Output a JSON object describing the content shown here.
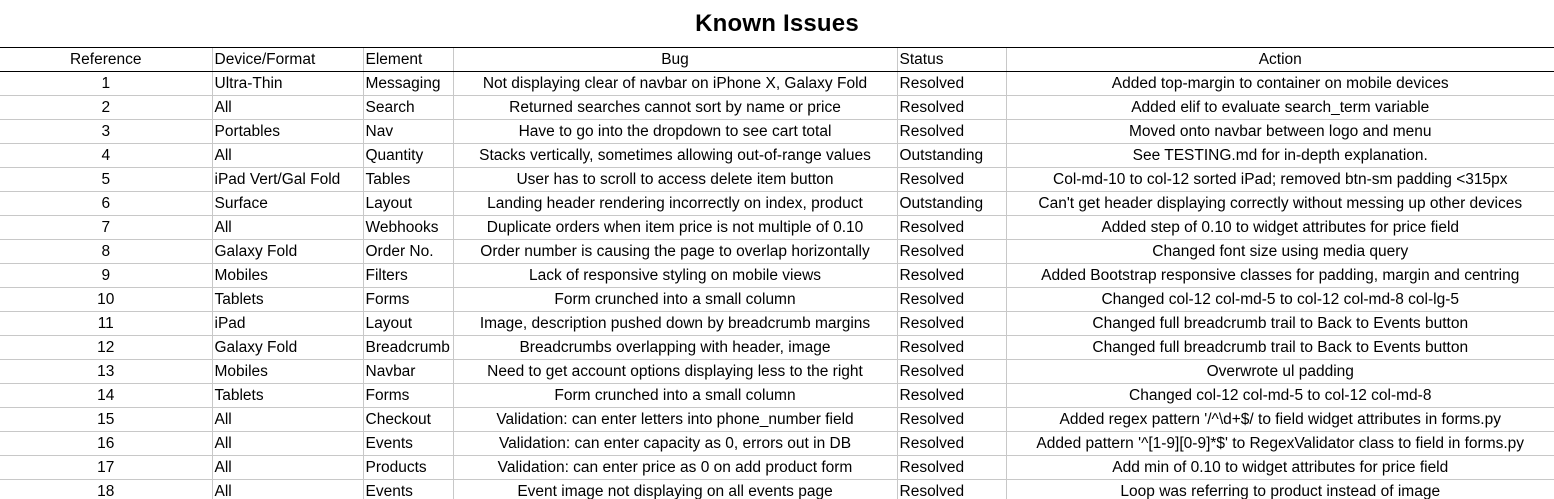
{
  "title": "Known Issues",
  "columns": [
    "Reference",
    "Device/Format",
    "Element",
    "Bug",
    "Status",
    "Action"
  ],
  "rows": [
    {
      "ref": "1",
      "device": "Ultra-Thin",
      "element": "Messaging",
      "bug": "Not displaying clear of navbar on iPhone X, Galaxy Fold",
      "status": "Resolved",
      "action": "Added top-margin to container on mobile devices"
    },
    {
      "ref": "2",
      "device": "All",
      "element": "Search",
      "bug": "Returned searches cannot sort by name or price",
      "status": "Resolved",
      "action": "Added elif to evaluate search_term variable"
    },
    {
      "ref": "3",
      "device": "Portables",
      "element": "Nav",
      "bug": "Have to go into the dropdown to see cart total",
      "status": "Resolved",
      "action": "Moved onto navbar between logo and menu"
    },
    {
      "ref": "4",
      "device": "All",
      "element": "Quantity",
      "bug": "Stacks vertically, sometimes allowing out-of-range values",
      "status": "Outstanding",
      "action": "See TESTING.md for in-depth explanation."
    },
    {
      "ref": "5",
      "device": "iPad Vert/Gal Fold",
      "element": "Tables",
      "bug": "User has to scroll to access delete item button",
      "status": "Resolved",
      "action": "Col-md-10 to col-12 sorted iPad; removed btn-sm padding <315px"
    },
    {
      "ref": "6",
      "device": "Surface",
      "element": "Layout",
      "bug": "Landing header rendering incorrectly on index, product",
      "status": "Outstanding",
      "action": "Can't get header displaying correctly without messing up other devices"
    },
    {
      "ref": "7",
      "device": "All",
      "element": "Webhooks",
      "bug": "Duplicate orders when item price is not multiple of 0.10",
      "status": "Resolved",
      "action": "Added step of 0.10 to widget attributes for price field"
    },
    {
      "ref": "8",
      "device": "Galaxy Fold",
      "element": "Order No.",
      "bug": "Order number is causing the page to overlap horizontally",
      "status": "Resolved",
      "action": "Changed font size using media query"
    },
    {
      "ref": "9",
      "device": "Mobiles",
      "element": "Filters",
      "bug": "Lack of responsive styling on mobile views",
      "status": "Resolved",
      "action": "Added Bootstrap responsive classes for padding, margin and centring"
    },
    {
      "ref": "10",
      "device": "Tablets",
      "element": "Forms",
      "bug": "Form crunched into a small column",
      "status": "Resolved",
      "action": "Changed col-12 col-md-5 to col-12 col-md-8 col-lg-5"
    },
    {
      "ref": "11",
      "device": "iPad",
      "element": "Layout",
      "bug": "Image, description pushed down by breadcrumb margins",
      "status": "Resolved",
      "action": "Changed full breadcrumb trail to Back to Events button"
    },
    {
      "ref": "12",
      "device": "Galaxy Fold",
      "element": "Breadcrumb",
      "bug": "Breadcrumbs overlapping with header, image",
      "status": "Resolved",
      "action": "Changed full breadcrumb trail to Back to Events button"
    },
    {
      "ref": "13",
      "device": "Mobiles",
      "element": "Navbar",
      "bug": "Need to get account options displaying less to the right",
      "status": "Resolved",
      "action": "Overwrote ul padding"
    },
    {
      "ref": "14",
      "device": "Tablets",
      "element": "Forms",
      "bug": "Form crunched into a small column",
      "status": "Resolved",
      "action": "Changed col-12 col-md-5 to col-12 col-md-8"
    },
    {
      "ref": "15",
      "device": "All",
      "element": "Checkout",
      "bug": "Validation: can enter letters into phone_number field",
      "status": "Resolved",
      "action": "Added regex pattern '/^\\d+$/ to field widget attributes in forms.py"
    },
    {
      "ref": "16",
      "device": "All",
      "element": "Events",
      "bug": "Validation: can enter capacity as 0, errors out in DB",
      "status": "Resolved",
      "action": "Added pattern '^[1-9][0-9]*$' to RegexValidator class to field in forms.py"
    },
    {
      "ref": "17",
      "device": "All",
      "element": "Products",
      "bug": "Validation: can enter price as 0 on add product form",
      "status": "Resolved",
      "action": "Add min of 0.10 to widget attributes for price field"
    },
    {
      "ref": "18",
      "device": "All",
      "element": "Events",
      "bug": "Event image not displaying on all events page",
      "status": "Resolved",
      "action": "Loop was referring to product instead of image"
    }
  ]
}
